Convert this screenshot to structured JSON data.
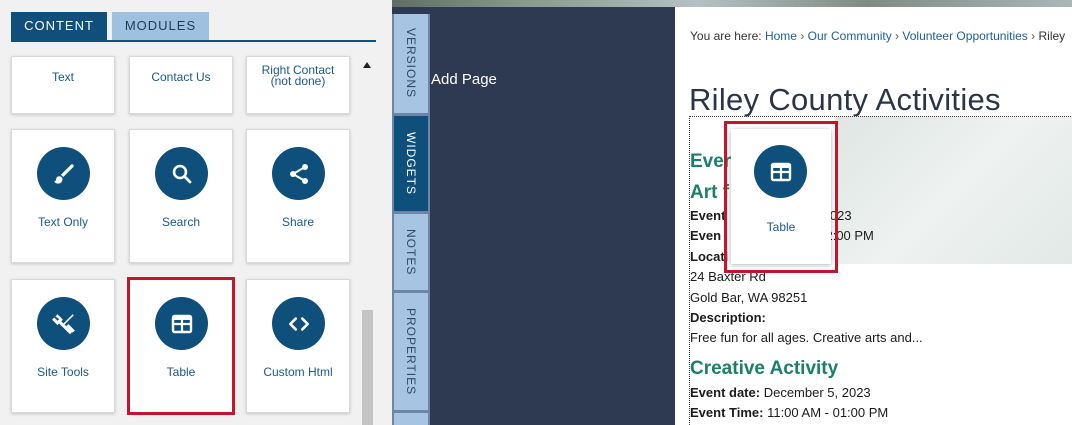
{
  "tabs": {
    "content": "CONTENT",
    "modules": "MODULES"
  },
  "widgets": {
    "row1": [
      "Text",
      "Contact Us",
      "Right Contact\n(not done)"
    ],
    "text_only": "Text Only",
    "search": "Search",
    "share": "Share",
    "site_tools": "Site Tools",
    "table": "Table",
    "custom_html": "Custom Html"
  },
  "side_tabs": {
    "versions": "VERSIONS",
    "widgets": "WIDGETS",
    "notes": "NOTES",
    "properties": "PROPERTIES"
  },
  "add_page": "Add Page",
  "breadcrumb": {
    "prefix": "You are here:",
    "items": [
      "Home",
      "Our Community",
      "Volunteer Opportunities",
      "Riley"
    ],
    "separator": "›"
  },
  "page": {
    "title": "Riley County Activities",
    "events_heading": "Ever",
    "event1": {
      "title": "Art f",
      "title_tail": "rs",
      "date_label": "Event",
      "date_value": "e 5, 2023",
      "time_label": "Even",
      "time_value": "/ - 02:00 PM",
      "location_label": "Locati",
      "address1": "24 Baxter Rd",
      "address2": "Gold Bar, WA 98251",
      "description_label": "Description:",
      "description": "Free fun for all ages. Creative arts and..."
    },
    "event2": {
      "title": "Creative Activity",
      "date_label": "Event date:",
      "date_value": "December 5, 2023",
      "time_label": "Event Time:",
      "time_value": "11:00 AM - 01:00 PM"
    }
  },
  "drag_ghost": {
    "label": "Table"
  },
  "colors": {
    "primary": "#0e4f7c",
    "highlight": "#c4162a",
    "accent_green": "#1c7f6b",
    "dark_panel": "#2e3a52"
  },
  "icons": [
    "brush-icon",
    "search-icon",
    "share-icon",
    "tools-icon",
    "table-icon",
    "code-icon"
  ]
}
